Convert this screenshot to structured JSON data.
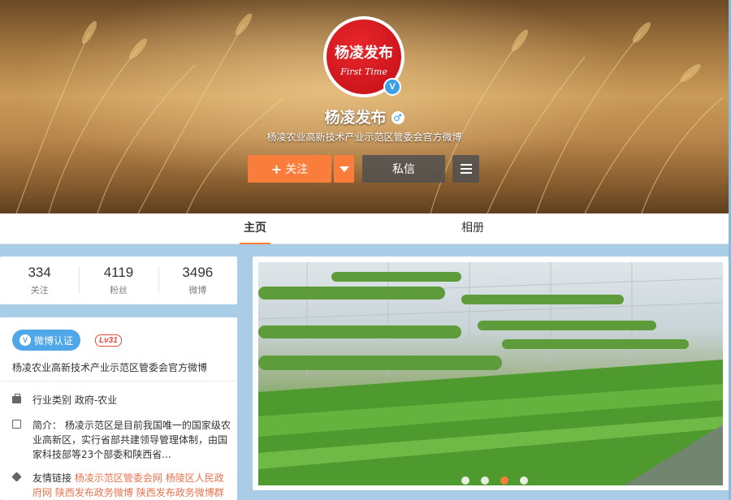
{
  "profile": {
    "name": "杨凌发布",
    "bio": "杨凌农业高新技术产业示范区管委会官方微博",
    "avatar_text": "杨凌发布",
    "avatar_sub": "First Time",
    "verified_mark": "V",
    "gender_symbol": "♂"
  },
  "actions": {
    "follow_label": "关注",
    "follow_plus": "+",
    "message_label": "私信"
  },
  "tabs": [
    {
      "label": "主页",
      "active": true
    },
    {
      "label": "相册",
      "active": false
    }
  ],
  "counts": [
    {
      "value": "334",
      "label": "关注"
    },
    {
      "value": "4119",
      "label": "粉丝"
    },
    {
      "value": "3496",
      "label": "微博"
    }
  ],
  "info": {
    "verify_badge": "微博认证",
    "verify_mark": "V",
    "level": "Lv31",
    "description": "杨凌农业高新技术产业示范区管委会官方微博",
    "industry": "行业类别  政府-农业",
    "intro": "简介： 杨凌示范区是目前我国唯一的国家级农业高新区，实行省部共建领导管理体制，由国家科技部等23个部委和陕西省...",
    "links_prefix": "友情链接",
    "links": [
      "杨凌示范区管委会网",
      "杨陵区人民政府网",
      "陕西发布政务微博",
      "陕西发布政务微博群"
    ]
  },
  "carousel": {
    "slide_count": 4,
    "active_index": 2
  },
  "colors": {
    "accent": "#fa7d3c",
    "page_bg": "#a9cde6",
    "verify_blue": "#4fa6e8",
    "link": "#eb7350"
  }
}
